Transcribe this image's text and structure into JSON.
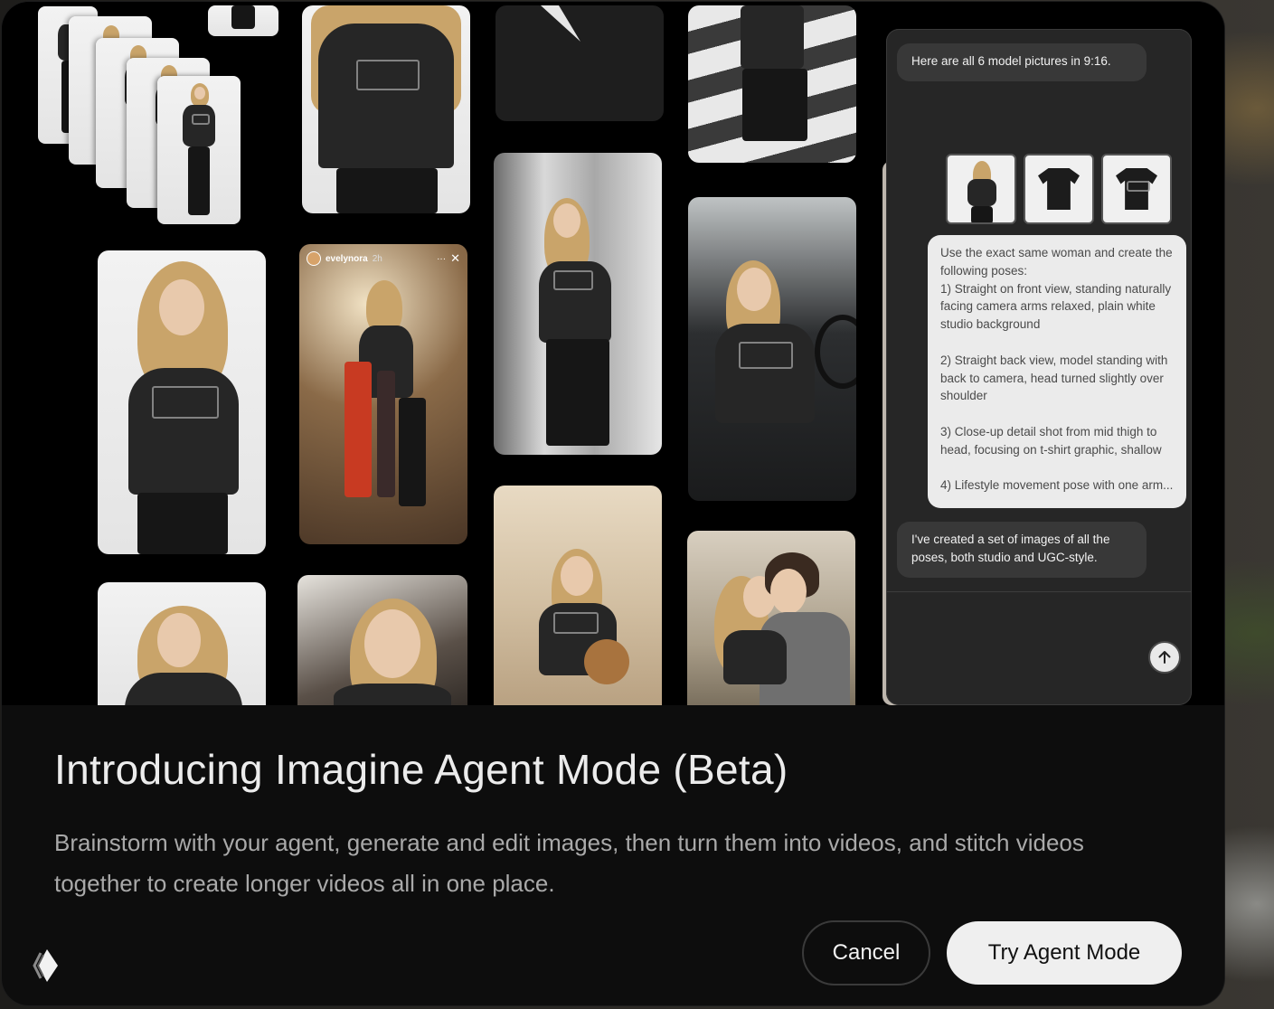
{
  "chat": {
    "message_intro": "Here are all 6 model pictures in 9:16.",
    "prompt_paragraphs": [
      "Use the exact same woman and create the following poses:\n1) Straight on front view, standing naturally facing camera arms relaxed, plain white studio background",
      "2) Straight back view, model standing with back to camera, head turned slightly over shoulder",
      "3) Close-up detail shot from mid thigh to head, focusing on t-shirt graphic, shallow"
    ],
    "prompt_last_line": "4) Lifestyle movement pose with one arm...",
    "message_result": "I've created a set of images of all the poses, both studio and UGC-style.",
    "send_icon": "arrow-up-icon"
  },
  "story": {
    "username": "evelynora",
    "time": "2h",
    "menu": "···",
    "close": "✕"
  },
  "modal": {
    "title": "Introducing Imagine Agent Mode (Beta)",
    "description": "Brainstorm with your agent, generate and edit images, then turn them into videos, and stitch videos together to create longer videos all in one place.",
    "cancel_label": "Cancel",
    "try_label": "Try Agent Mode"
  },
  "colors": {
    "modal_bg": "#0d0d0d",
    "primary_button": "#efefef",
    "chat_panel": "#262626"
  }
}
